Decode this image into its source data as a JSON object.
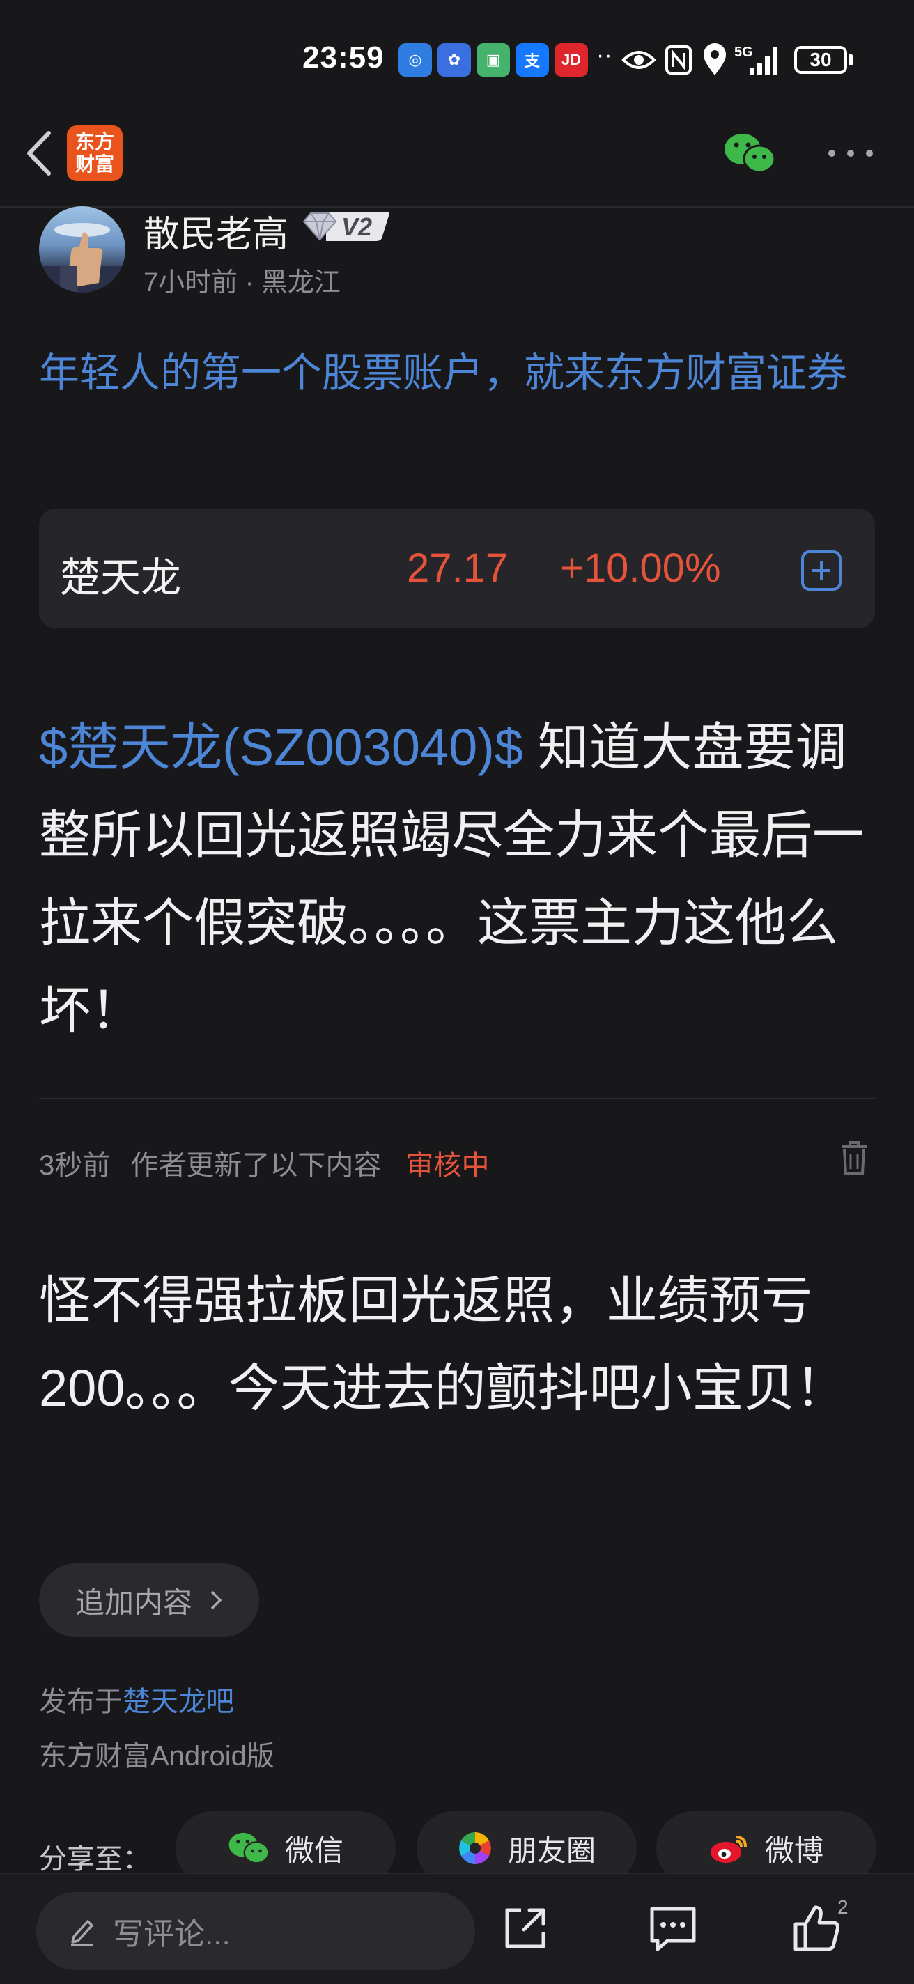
{
  "status_bar": {
    "time": "23:59",
    "network": "5G",
    "battery": "30"
  },
  "nav": {
    "app_logo_line1": "东方",
    "app_logo_line2": "财富"
  },
  "author": {
    "name": "散民老高",
    "badge": "V2",
    "meta": "7小时前 · 黑龙江"
  },
  "promo_text": "年轻人的第一个股票账户，就来东方财富证券",
  "stock": {
    "name": "楚天龙",
    "price": "27.17",
    "change": "+10.00%"
  },
  "post": {
    "tag": "$楚天龙(SZ003040)$",
    "text": "  知道大盘要调整所以回光返照竭尽全力来个最后一拉来个假突破。。。。这票主力这他么坏！"
  },
  "update": {
    "time": "3秒前",
    "label": "作者更新了以下内容",
    "status": "审核中"
  },
  "post_update_text": "怪不得强拉板回光返照，业绩预亏200。。。今天进去的颤抖吧小宝贝！",
  "add_content_button": "追加内容",
  "published": {
    "prefix": "发布于",
    "bar": "楚天龙吧"
  },
  "client": "东方财富Android版",
  "share": {
    "label": "分享至：",
    "wechat": "微信",
    "moments": "朋友圈",
    "weibo": "微博"
  },
  "bottom_bar": {
    "comment_placeholder": "写评论...",
    "like_count": "2"
  },
  "colors": {
    "background": "#18181a",
    "link_blue": "#4d86d6",
    "up_red": "#e5533b",
    "logo_orange": "#e9541d",
    "wechat_green": "#3fb84a"
  }
}
